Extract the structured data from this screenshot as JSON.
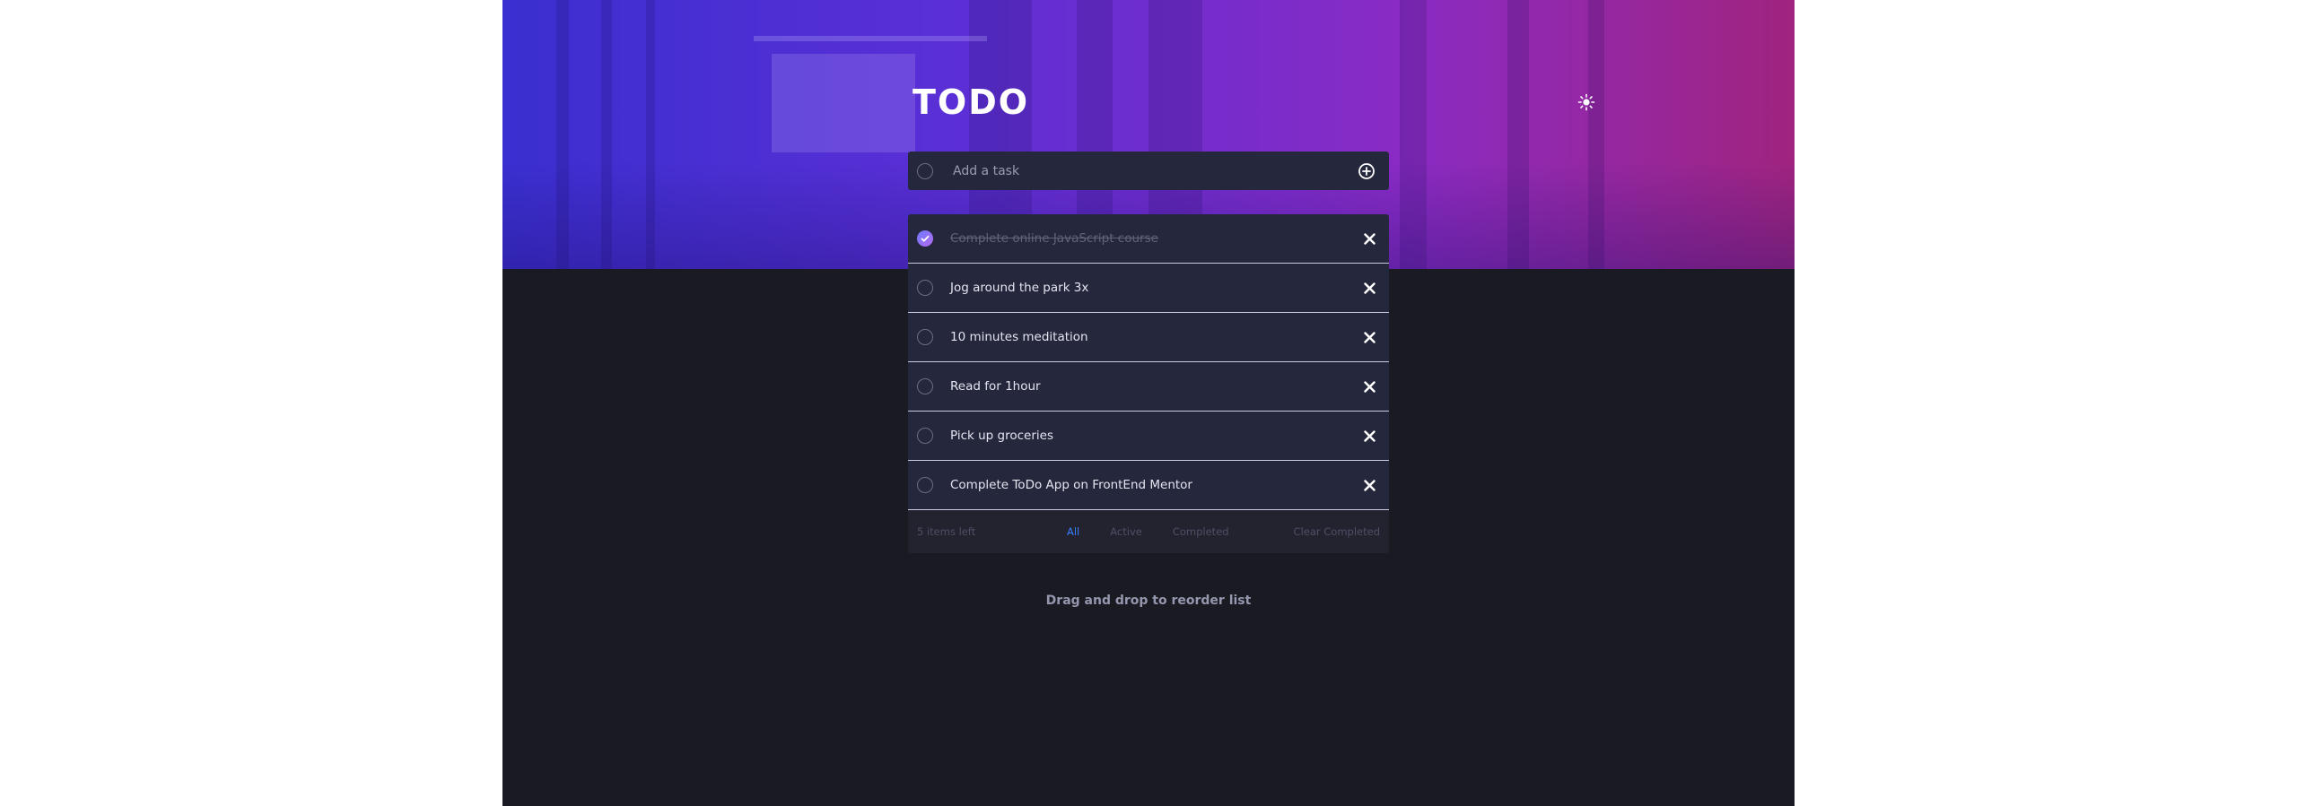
{
  "app": {
    "title": "TODO",
    "theme_toggle_icon": "sun-icon"
  },
  "new_task": {
    "placeholder": "Add a task",
    "value": "",
    "add_icon": "plus-circle-icon"
  },
  "todos": [
    {
      "label": "Complete online JavaScript course",
      "completed": true
    },
    {
      "label": "Jog around the park 3x",
      "completed": false
    },
    {
      "label": "10 minutes meditation",
      "completed": false
    },
    {
      "label": "Read for 1hour",
      "completed": false
    },
    {
      "label": "Pick up groceries",
      "completed": false
    },
    {
      "label": "Complete ToDo App on FrontEnd Mentor",
      "completed": false
    }
  ],
  "footer": {
    "items_left": "5 items left",
    "filters": [
      {
        "label": "All",
        "active": true
      },
      {
        "label": "Active",
        "active": false
      },
      {
        "label": "Completed",
        "active": false
      }
    ],
    "clear_label": "Clear Completed"
  },
  "hint": "Drag and drop to reorder list",
  "colors": {
    "background": "#1a1a23",
    "card": "#25273c",
    "accent": "#3a7cfd",
    "check_gradient_start": "#6d7bff",
    "check_gradient_end": "#b56bf2"
  }
}
